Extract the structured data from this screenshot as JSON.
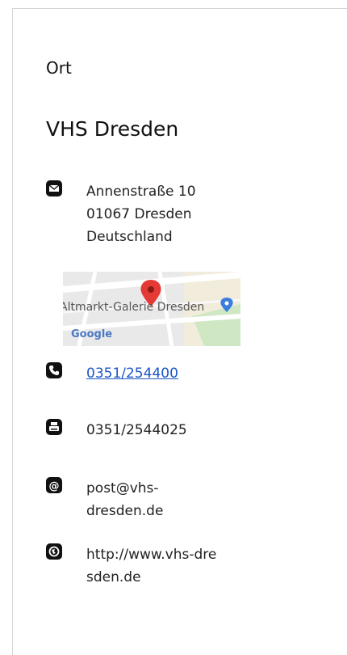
{
  "section": {
    "label": "Ort"
  },
  "venue": {
    "name": "VHS Dresden"
  },
  "address": {
    "icon": "envelope-icon",
    "lines": "Annenstraße 10\n01067 Dresden\nDeutschland"
  },
  "map": {
    "place_label": "Altmarkt-Galerie Dresden",
    "brand": "Google"
  },
  "phone": {
    "icon": "phone-icon",
    "value": "0351/254400"
  },
  "fax": {
    "icon": "printer-icon",
    "value": "0351/2544025"
  },
  "email": {
    "icon": "at-sign-icon",
    "value": "post@vhs-\ndresden.de"
  },
  "website": {
    "icon": "globe-icon",
    "value": "http://www.vhs-dre\nsden.de"
  },
  "colors": {
    "link": "#1a56c8",
    "pin": "#e53935",
    "map_accent": "#3b7ddd"
  }
}
